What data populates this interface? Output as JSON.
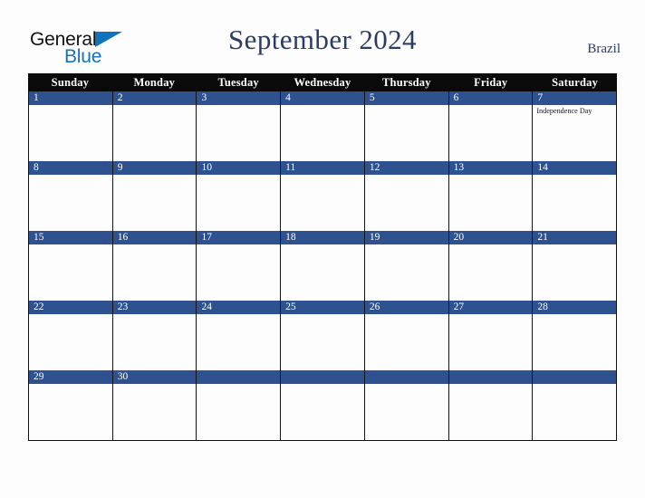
{
  "brand": {
    "logo_text_top": "General",
    "logo_text_bottom": "Blue",
    "logo_triangle_icon": "blue-triangle-icon",
    "logo_color": "#1273bd"
  },
  "header": {
    "title": "September 2024",
    "country": "Brazil",
    "title_color": "#2b3c63"
  },
  "calendar": {
    "month": "September",
    "year": "2024",
    "accent_color": "#2e5290",
    "weekday_header_bg": "#0a0a0a",
    "weekdays": [
      "Sunday",
      "Monday",
      "Tuesday",
      "Wednesday",
      "Thursday",
      "Friday",
      "Saturday"
    ],
    "weeks": [
      [
        {
          "date": "1",
          "events": []
        },
        {
          "date": "2",
          "events": []
        },
        {
          "date": "3",
          "events": []
        },
        {
          "date": "4",
          "events": []
        },
        {
          "date": "5",
          "events": []
        },
        {
          "date": "6",
          "events": []
        },
        {
          "date": "7",
          "events": [
            "Independence Day"
          ]
        }
      ],
      [
        {
          "date": "8",
          "events": []
        },
        {
          "date": "9",
          "events": []
        },
        {
          "date": "10",
          "events": []
        },
        {
          "date": "11",
          "events": []
        },
        {
          "date": "12",
          "events": []
        },
        {
          "date": "13",
          "events": []
        },
        {
          "date": "14",
          "events": []
        }
      ],
      [
        {
          "date": "15",
          "events": []
        },
        {
          "date": "16",
          "events": []
        },
        {
          "date": "17",
          "events": []
        },
        {
          "date": "18",
          "events": []
        },
        {
          "date": "19",
          "events": []
        },
        {
          "date": "20",
          "events": []
        },
        {
          "date": "21",
          "events": []
        }
      ],
      [
        {
          "date": "22",
          "events": []
        },
        {
          "date": "23",
          "events": []
        },
        {
          "date": "24",
          "events": []
        },
        {
          "date": "25",
          "events": []
        },
        {
          "date": "26",
          "events": []
        },
        {
          "date": "27",
          "events": []
        },
        {
          "date": "28",
          "events": []
        }
      ],
      [
        {
          "date": "29",
          "events": []
        },
        {
          "date": "30",
          "events": []
        },
        {
          "date": "",
          "events": []
        },
        {
          "date": "",
          "events": []
        },
        {
          "date": "",
          "events": []
        },
        {
          "date": "",
          "events": []
        },
        {
          "date": "",
          "events": []
        }
      ]
    ]
  }
}
